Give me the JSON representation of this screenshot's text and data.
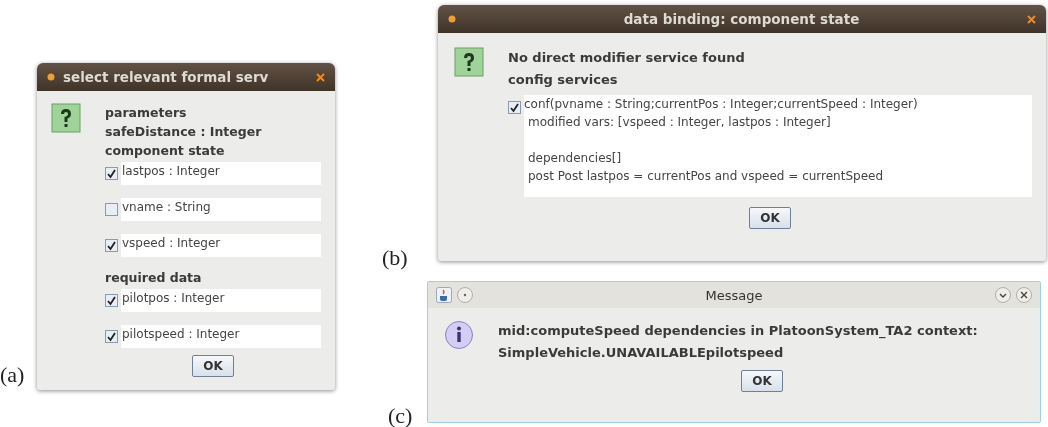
{
  "panel_a": {
    "label": "(a)",
    "title": "select relevant formal serv",
    "groups": [
      {
        "heading": "parameters",
        "lines": [
          "safeDistance : Integer"
        ]
      },
      {
        "heading": "component state",
        "options": [
          {
            "label": "lastpos : Integer",
            "checked": true
          },
          {
            "label": "vname : String",
            "checked": false
          },
          {
            "label": "vspeed : Integer",
            "checked": true
          }
        ]
      },
      {
        "heading": "required data",
        "options": [
          {
            "label": "pilotpos : Integer",
            "checked": true
          },
          {
            "label": "pilotspeed : Integer",
            "checked": true
          }
        ]
      }
    ],
    "button": "OK"
  },
  "panel_b": {
    "label": "(b)",
    "title": "data binding: component state",
    "message_lines": [
      "No direct modifier service found",
      "config services"
    ],
    "option": {
      "label": "conf(pvname : String;currentPos : Integer;currentSpeed : Integer)",
      "checked": true,
      "detail_blocks": [
        [
          "modified vars: [vspeed : Integer, lastpos : Integer]"
        ],
        [
          "dependencies[]",
          "post Post lastpos = currentPos and vspeed = currentSpeed"
        ]
      ]
    },
    "button": "OK"
  },
  "panel_c": {
    "label": "(c)",
    "title": "Message",
    "message_lines": [
      "mid:computeSpeed dependencies in PlatoonSystem_TA2 context:",
      "SimpleVehicle.UNAVAILABLEpilotspeed"
    ],
    "button": "OK"
  }
}
